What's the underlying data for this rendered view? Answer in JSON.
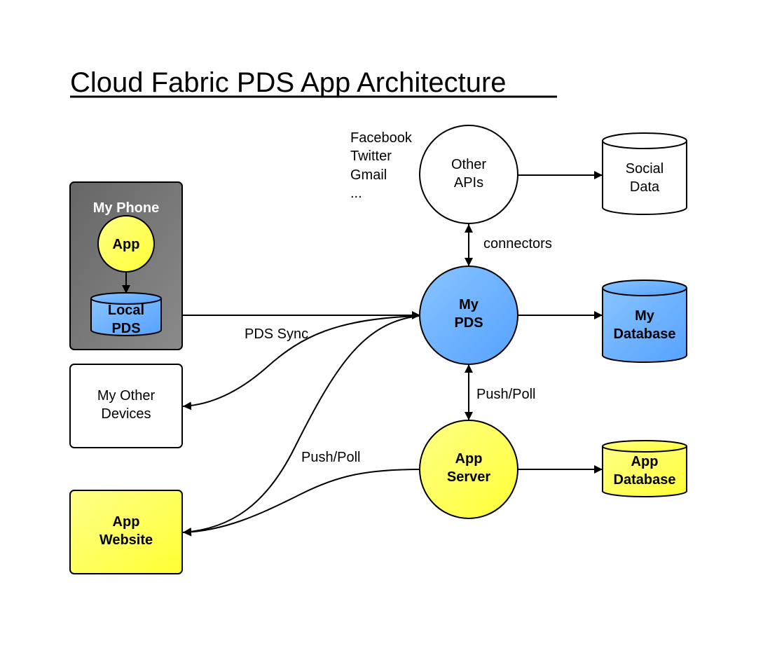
{
  "title": "Cloud Fabric PDS App Architecture",
  "colors": {
    "yellow": "#ffff44",
    "blue": "#66aaff",
    "gray_box": "#7a7a7a",
    "white": "#ffffff"
  },
  "nodes": {
    "my_phone": {
      "label": "My Phone"
    },
    "app": {
      "label": "App"
    },
    "local_pds": {
      "line1": "Local",
      "line2": "PDS"
    },
    "my_other_devices": {
      "line1": "My Other",
      "line2": "Devices"
    },
    "app_website": {
      "line1": "App",
      "line2": "Website"
    },
    "other_apis": {
      "line1": "Other",
      "line2": "APIs"
    },
    "my_pds": {
      "line1": "My",
      "line2": "PDS"
    },
    "app_server": {
      "line1": "App",
      "line2": "Server"
    },
    "social_data": {
      "line1": "Social",
      "line2": "Data"
    },
    "my_database": {
      "line1": "My",
      "line2": "Database"
    },
    "app_database": {
      "line1": "App",
      "line2": "Database"
    }
  },
  "api_list": [
    "Facebook",
    "Twitter",
    "Gmail",
    "..."
  ],
  "edge_labels": {
    "connectors": "connectors",
    "pds_sync": "PDS Sync",
    "push_poll_server": "Push/Poll",
    "push_poll_website": "Push/Poll"
  }
}
